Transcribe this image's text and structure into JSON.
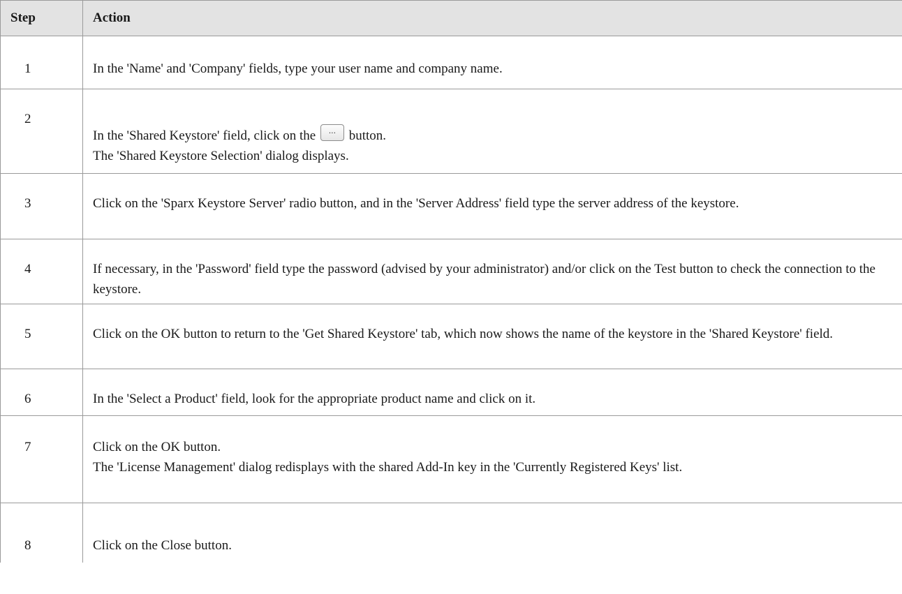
{
  "table": {
    "headers": {
      "step": "Step",
      "action": "Action"
    },
    "rows": [
      {
        "step": "1",
        "lines": [
          "In the 'Name' and 'Company' fields, type your user name and company name."
        ]
      },
      {
        "step": "2",
        "line_before_button": "In the 'Shared Keystore' field, click on the",
        "button_label": "...",
        "line_after_button": "button.",
        "lines": [
          "The 'Shared Keystore Selection' dialog displays."
        ]
      },
      {
        "step": "3",
        "lines": [
          "Click on the 'Sparx Keystore Server' radio button, and in the 'Server Address' field type the server address of the keystore."
        ]
      },
      {
        "step": "4",
        "lines": [
          "If necessary, in the 'Password' field type the password (advised by your administrator) and/or click on the Test button to check the connection to the keystore."
        ]
      },
      {
        "step": "5",
        "lines": [
          "Click on the OK button to return to the 'Get Shared Keystore' tab, which now shows the name of the keystore in the 'Shared Keystore' field."
        ]
      },
      {
        "step": "6",
        "lines": [
          "In the 'Select a Product' field, look for the appropriate product name and click on it."
        ]
      },
      {
        "step": "7",
        "lines": [
          "Click on the OK button.",
          "The 'License Management' dialog redisplays with the shared Add-In key in the 'Currently Registered Keys' list."
        ]
      },
      {
        "step": "8",
        "lines": [
          "Click on the Close button."
        ]
      }
    ]
  }
}
